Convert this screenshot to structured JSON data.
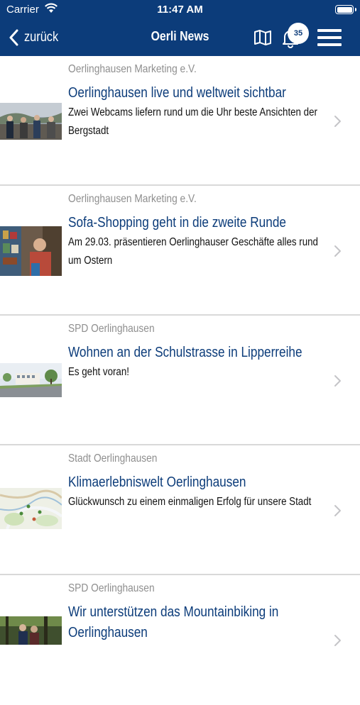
{
  "status_bar": {
    "carrier": "Carrier",
    "time": "11:47 AM"
  },
  "nav": {
    "back_label": "zurück",
    "title": "Oerli News",
    "notification_count": "35",
    "icons": [
      "back-chevron-icon",
      "map-icon",
      "bell-icon",
      "hamburger-menu-icon"
    ]
  },
  "colors": {
    "brand": "#0c3c7a",
    "source_text": "#8e8e8e",
    "divider": "#d9d9d9"
  },
  "news": [
    {
      "source": "Oerlinghausen Marketing e.V.",
      "title": "Oerlinghausen live und weltweit sichtbar",
      "teaser": "Zwei Webcams liefern rund um die Uhr beste Ansichten der Bergstadt",
      "image": "group-photo-viewpoint"
    },
    {
      "source": "Oerlinghausen Marketing e.V.",
      "title": "Sofa-Shopping geht in die zweite Runde",
      "teaser": "Am 29.03. präsentieren Oerlinghauser Geschäfte alles rund um Ostern",
      "image": "shop-owner-photo"
    },
    {
      "source": "SPD Oerlinghausen",
      "title": "Wohnen an der Schulstrasse in Lipperreihe",
      "teaser": "Es geht voran!",
      "image": "street-housing-photo"
    },
    {
      "source": "Stadt Oerlinghausen",
      "title": "Klimaerlebniswelt Oerlinghausen",
      "teaser": "Glückwunsch zu einem einmaligen Erfolg für unsere Stadt",
      "image": "map-image"
    },
    {
      "source": "SPD Oerlinghausen",
      "title": "Wir unterstützen das Mountainbiking in Oerlinghausen",
      "teaser": "",
      "image": "forest-bikers-photo"
    }
  ]
}
